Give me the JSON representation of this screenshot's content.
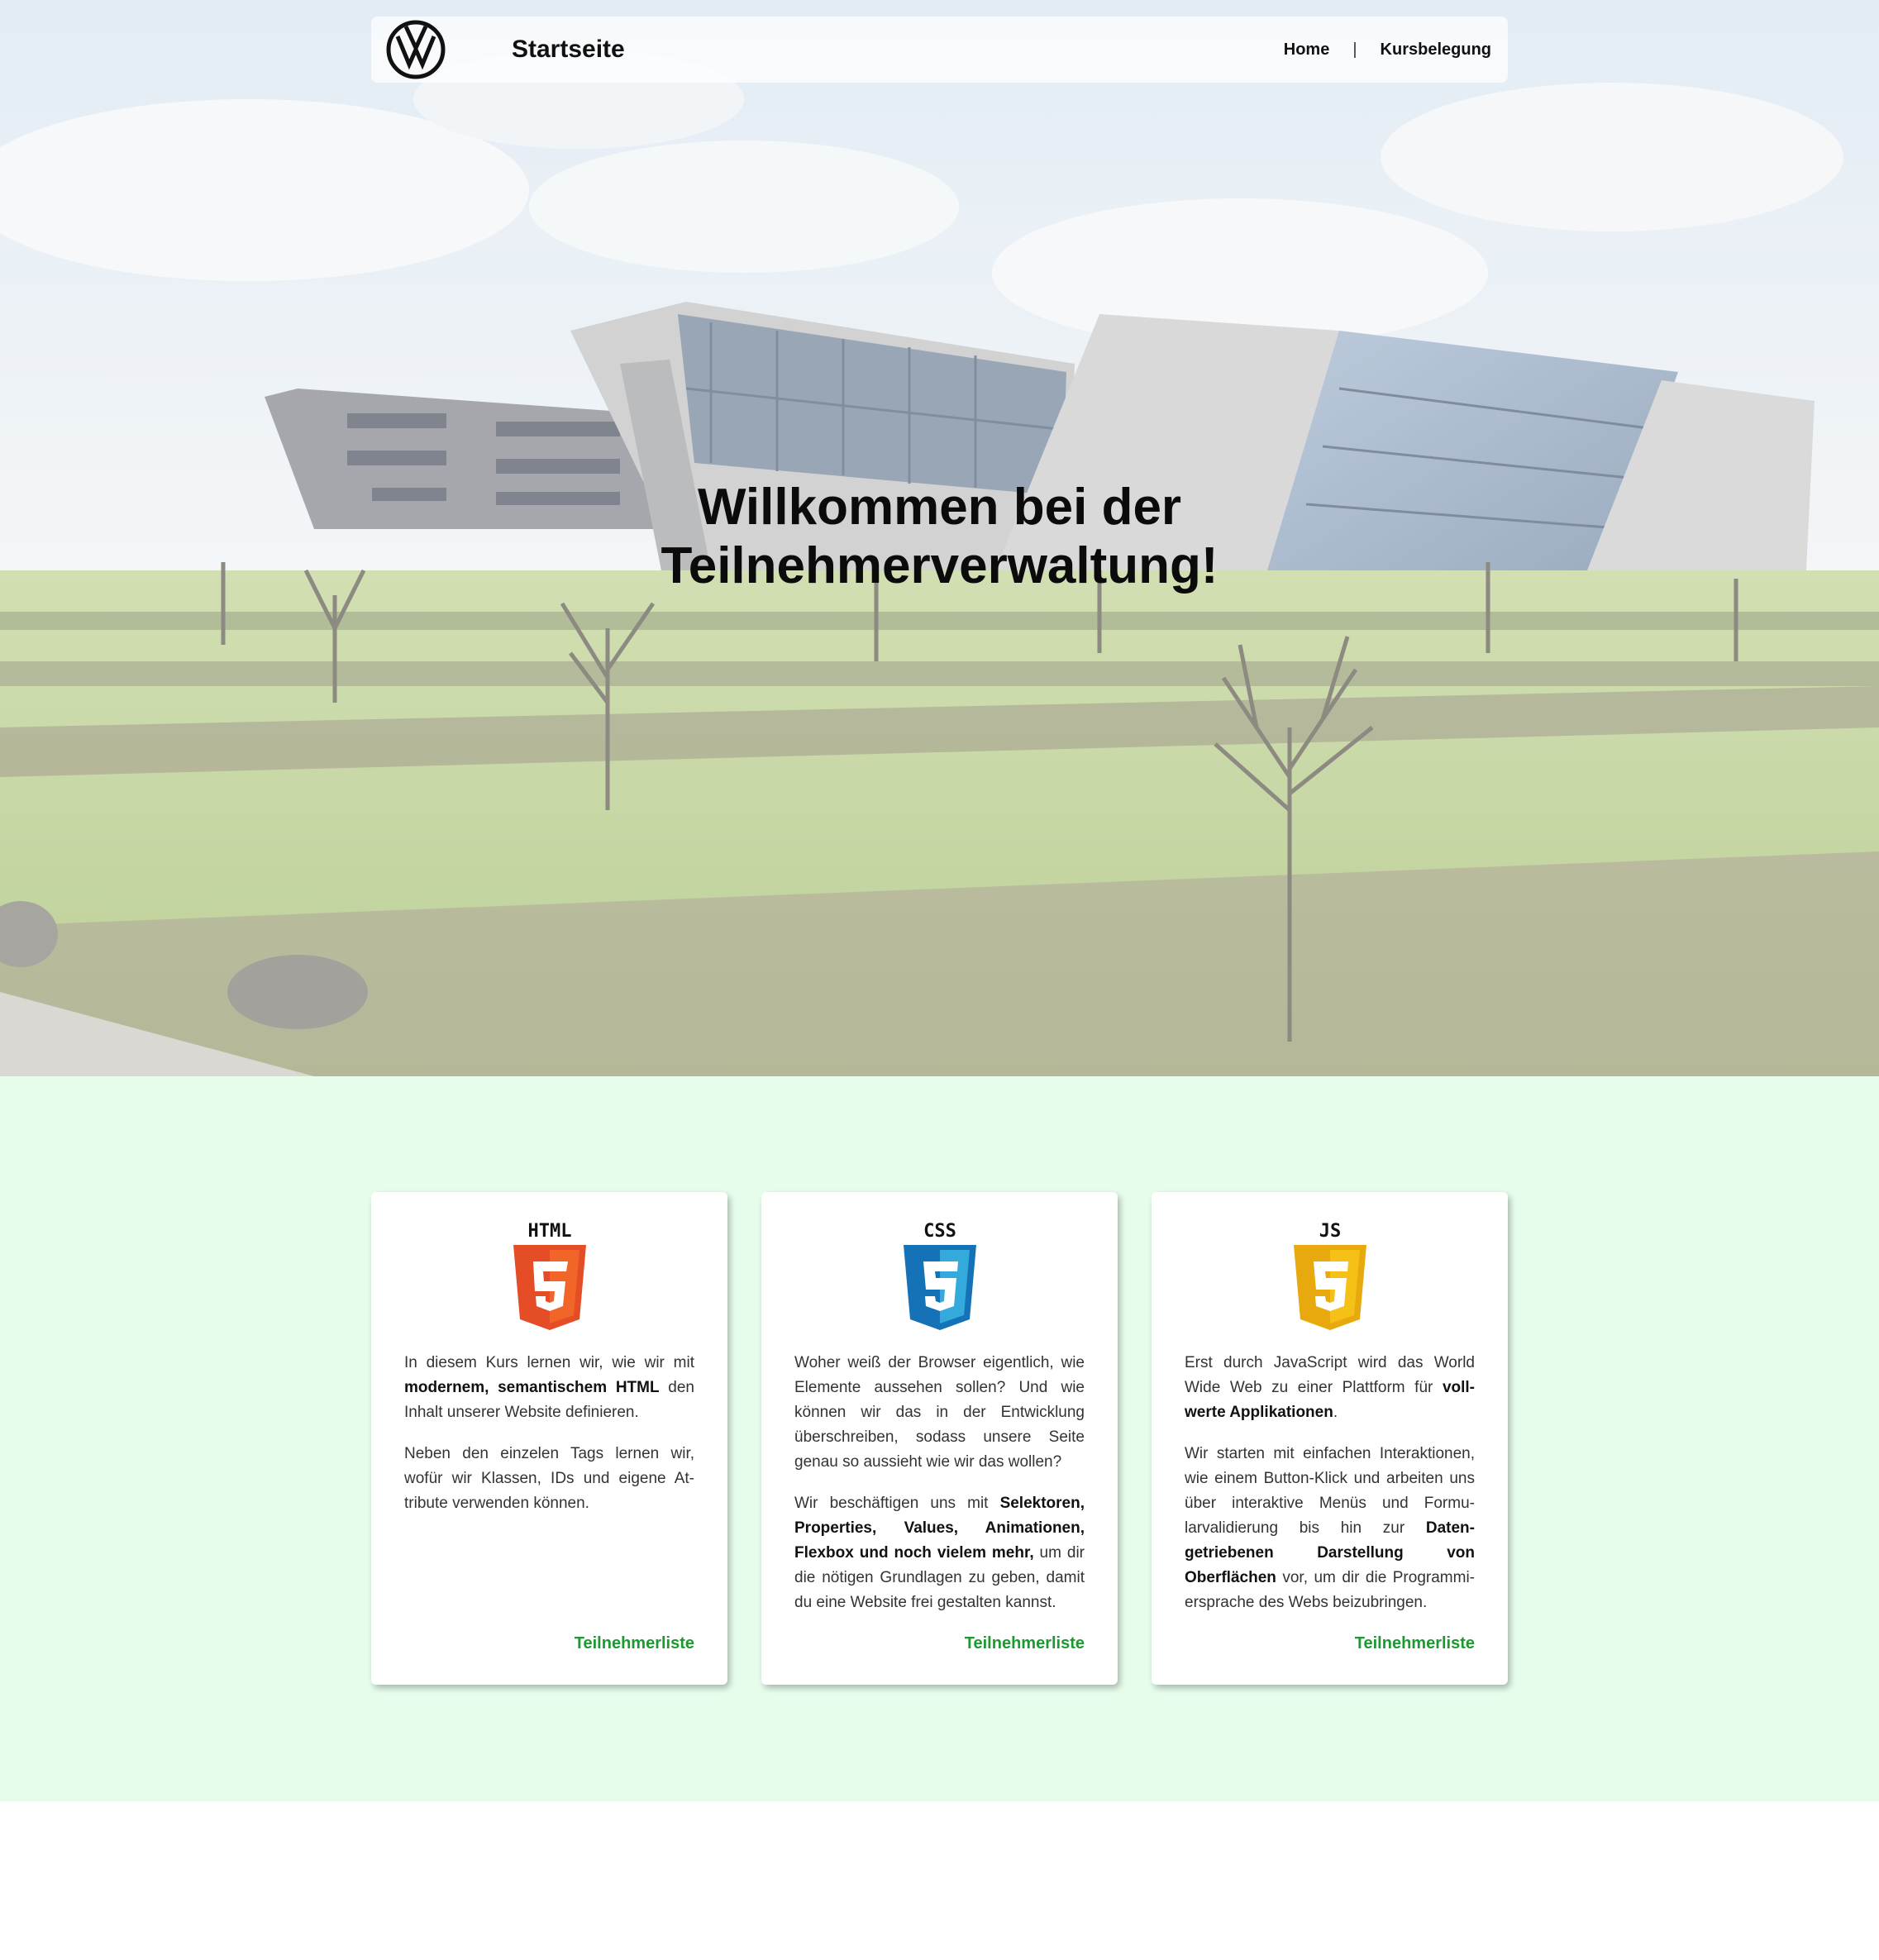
{
  "navbar": {
    "logo": "vw-logo",
    "title": "Startseite",
    "links": [
      "Home",
      "Kursbelegung"
    ],
    "separator": "|"
  },
  "hero": {
    "heading_line1": "Willkommen bei der",
    "heading_line2": "Teilnehmerverwaltung!"
  },
  "courses": {
    "background": "#e7fdec",
    "link_color": "#1a9a30",
    "cards": [
      {
        "icon": "html5-icon",
        "icon_label": "HTML",
        "icon_color": "#e44d26",
        "p1": [
          {
            "t": "In diesem Kurs lernen wir, wie wir mit "
          },
          {
            "t": "modernem, semantischem HTML",
            "b": true
          },
          {
            "t": " den Inhalt unserer Website definieren."
          }
        ],
        "p2": [
          {
            "t": "Neben den einzelen Tags lernen wir, wofür wir Klassen, IDs und eigene At­tribute verwenden können."
          }
        ],
        "link": "Teilnehmerliste"
      },
      {
        "icon": "css3-icon",
        "icon_label": "CSS",
        "icon_color": "#1572b6",
        "p1": [
          {
            "t": "Woher weiß der Browser eigentlich, wie Elemente aussehen sollen? Und wie können wir das in der Entwicklung überschreiben, sodass unsere Seite genau so aussieht wie wir das wollen?"
          }
        ],
        "p2": [
          {
            "t": "Wir beschäftigen uns mit "
          },
          {
            "t": "Selektoren, Properties, Values, Animationen, Flexbox und noch vielem mehr,",
            "b": true
          },
          {
            "t": " um dir die nötigen Grundlagen zu geben, damit du eine Website frei gestalten kannst."
          }
        ],
        "link": "Teilnehmerliste"
      },
      {
        "icon": "js-icon",
        "icon_label": "JS",
        "icon_color": "#e8a90f",
        "p1": [
          {
            "t": "Erst durch JavaScript wird das World Wide Web zu einer Plattform für "
          },
          {
            "t": "voll­werte Applikationen",
            "b": true
          },
          {
            "t": "."
          }
        ],
        "p2": [
          {
            "t": "Wir starten mit einfachen Interaktionen, wie einem Button-Klick und arbeiten uns über interaktive Menüs und Formu­larvalidierung bis hin zur "
          },
          {
            "t": "Daten­getriebenen Darstellung von Oberflächen",
            "b": true
          },
          {
            "t": " vor, um dir die Programmi­ersprache des Webs beizubringen."
          }
        ],
        "link": "Teilnehmerliste"
      }
    ]
  }
}
